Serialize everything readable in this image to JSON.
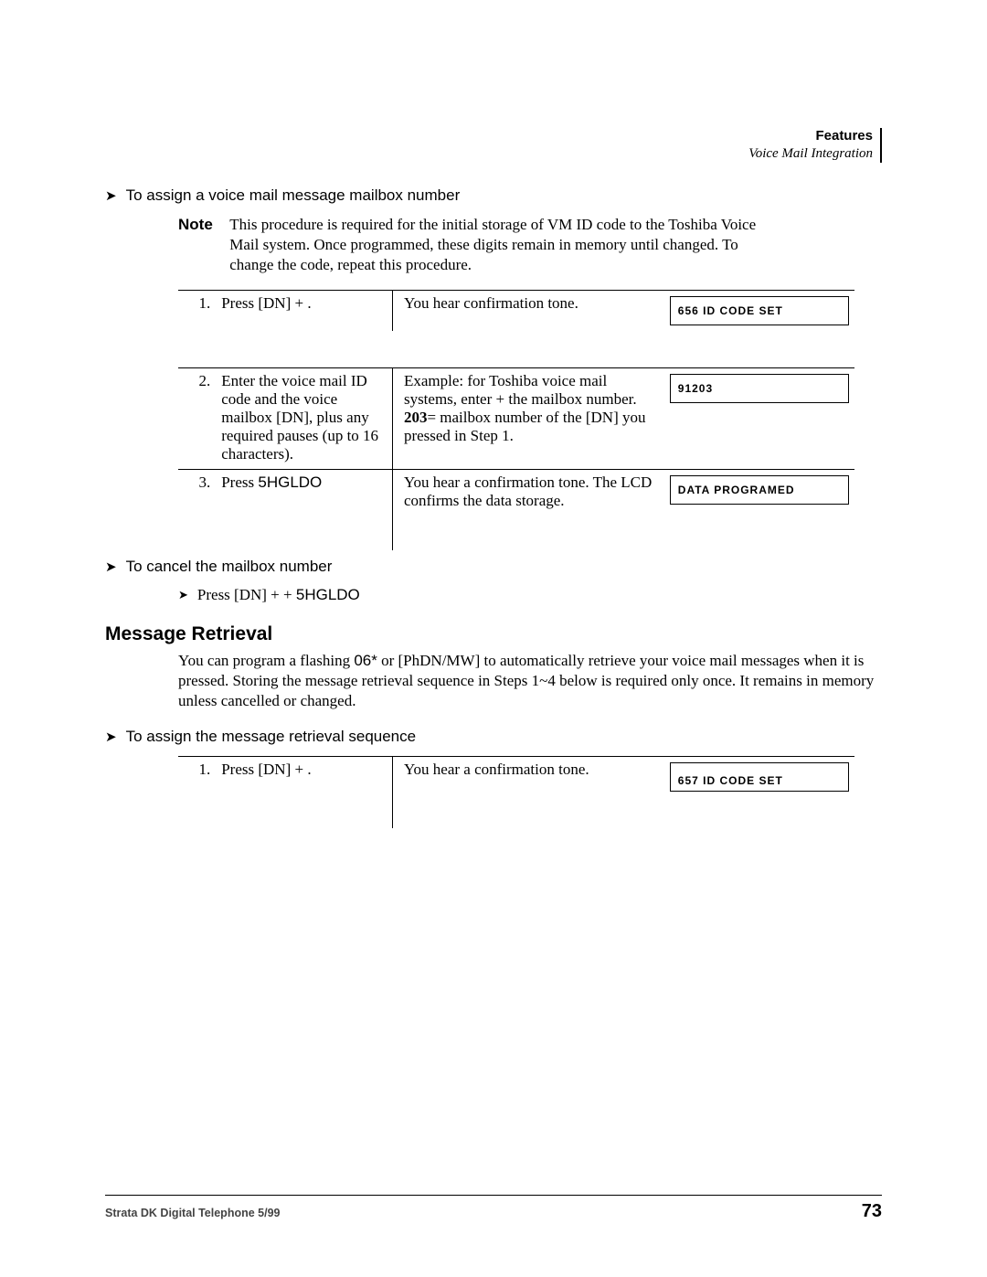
{
  "header": {
    "features": "Features",
    "subtitle": "Voice Mail Integration"
  },
  "proc1": {
    "title": "To assign a voice mail message mailbox number",
    "note_label": "Note",
    "note_text": "This procedure is required for the initial storage of VM ID code to the Toshiba Voice Mail system. Once programmed, these digits remain in memory until changed. To change the code, repeat this procedure.",
    "steps": [
      {
        "num": "1.",
        "instr_a": "Press [DN] + ",
        "instr_b": ".",
        "desc": "You hear confirmation tone.",
        "lcd": "656  ID  CODE  SET"
      },
      {
        "num": "2.",
        "instr": "Enter the voice mail ID code and the voice mailbox [DN], plus any required pauses (up to 16 characters).",
        "desc_a": "Example: for Toshiba voice mail systems, enter ",
        "desc_b": " + the mailbox number.",
        "desc2_a": "203",
        "desc2_b": "= mailbox number of the [DN] you pressed in Step 1.",
        "lcd": "91203"
      },
      {
        "num": "3.",
        "instr_a": "Press ",
        "instr_b": "5HGLDO",
        "desc": "You hear a confirmation tone. The LCD confirms the data storage.",
        "lcd": "DATA  PROGRAMED"
      }
    ]
  },
  "proc2": {
    "title": "To cancel the mailbox number",
    "sub_a": "Press [DN] + ",
    "sub_b": " + ",
    "sub_c": "5HGLDO"
  },
  "section2": {
    "heading": "Message Retrieval",
    "para_a": "You can program a flashing ",
    "para_b": "06*",
    "para_c": " or [PhDN/MW] to automatically retrieve your voice mail messages when it is pressed. Storing the message retrieval sequence in Steps 1~4 below is required only once. It remains in memory unless cancelled or changed."
  },
  "proc3": {
    "title": "To assign the message retrieval sequence",
    "steps": [
      {
        "num": "1.",
        "instr_a": "Press [DN] + ",
        "instr_b": ".",
        "desc": "You hear a confirmation tone.",
        "lcd": "657 ID CODE SET"
      }
    ]
  },
  "footer": {
    "left": "Strata DK Digital Telephone   5/99",
    "page": "73"
  }
}
